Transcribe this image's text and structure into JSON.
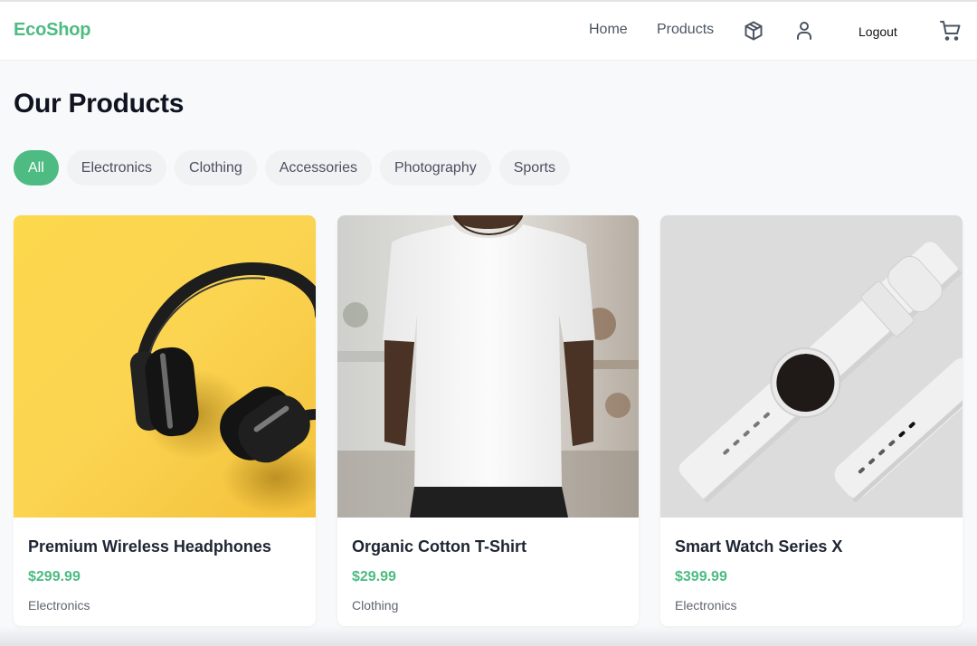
{
  "app": {
    "brand": "EcoShop",
    "accent_color": "#4dbb82"
  },
  "nav": {
    "home": "Home",
    "products": "Products",
    "orders_icon": "package-icon",
    "profile_icon": "user-icon",
    "logout": "Logout",
    "cart_icon": "shopping-cart-icon"
  },
  "page": {
    "title": "Our Products"
  },
  "filters": {
    "active": "All",
    "items": [
      "All",
      "Electronics",
      "Clothing",
      "Accessories",
      "Photography",
      "Sports"
    ]
  },
  "products": [
    {
      "name": "Premium Wireless Headphones",
      "price": "$299.99",
      "category": "Electronics",
      "image": "headphones on yellow background"
    },
    {
      "name": "Organic Cotton T-Shirt",
      "price": "$29.99",
      "category": "Clothing",
      "image": "man wearing white t-shirt"
    },
    {
      "name": "Smart Watch Series X",
      "price": "$399.99",
      "category": "Electronics",
      "image": "white smart watch"
    }
  ]
}
